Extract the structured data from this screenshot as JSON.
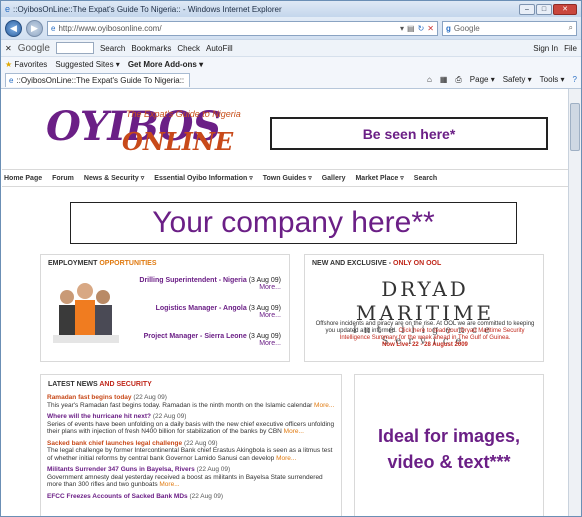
{
  "window": {
    "title": "::OyibosOnLine::The Expat's Guide To Nigeria:: - Windows Internet Explorer",
    "url": "http://www.oyibosonline.com/",
    "search_engine": "Google"
  },
  "google_toolbar": {
    "label": "Google",
    "items": [
      "Search",
      "Bookmarks",
      "Check",
      "AutoFill",
      "Sign In",
      "File"
    ]
  },
  "favorites_bar": {
    "favorites": "Favorites",
    "suggested": "Suggested Sites ▾",
    "addons": "Get More Add-ons ▾"
  },
  "tab": {
    "title": "::OyibosOnLine::The Expat's Guide To Nigeria::"
  },
  "tab_tools": [
    "Page ▾",
    "Safety ▾",
    "Tools ▾"
  ],
  "site": {
    "logo_main": "OYIBOS",
    "logo_sub": "ONLINE",
    "tagline": "The Expat's Guide to Nigeria",
    "banner_top": "Be seen here*",
    "banner_mid": "Your company here**",
    "nav": [
      "Home Page",
      "Forum",
      "News & Security",
      "Essential Oyibo Information",
      "Town Guides",
      "Gallery",
      "Market Place",
      "Search"
    ],
    "employment": {
      "title": "EMPLOYMENT",
      "title_accent": "OPPORTUNITIES",
      "jobs": [
        {
          "title": "Drilling Superintendent - Nigeria",
          "date": "(3 Aug 09)",
          "more": "More..."
        },
        {
          "title": "Logistics Manager - Angola",
          "date": "(3 Aug 09)",
          "more": "More..."
        },
        {
          "title": "Project Manager - Sierra Leone",
          "date": "(3 Aug 09)",
          "more": "More..."
        }
      ]
    },
    "exclusive": {
      "title": "NEW AND EXCLUSIVE -",
      "title_accent": "ONLY ON OOL",
      "brand_line1": "DRYAD MARITIME",
      "brand_line2": "Intelligence Service",
      "text": "Offshore incidents and piracy are on the rise. At OOL we are committed to keeping you updated and informed.",
      "link": "Click here to read your Dryad Maritime Security Intelligence Summary for the week ahead in The Gulf of Guinea.",
      "live": "Now Live: 22 - 28 August 2009"
    },
    "latest_news": {
      "title": "LATEST NEWS",
      "title_accent": "AND SECURITY",
      "items": [
        {
          "headline": "Ramadan fast begins today",
          "date": "(22 Aug 09)",
          "body": "This year's Ramadan fast begins today. Ramadan is the ninth month on the Islamic calendar",
          "more": "More...",
          "color": "orange"
        },
        {
          "headline": "Where will the hurricane hit next?",
          "date": "(22 Aug 09)",
          "body": "Series of events have been unfolding on a daily basis with the new chief executive officers unfolding their plans with injection of fresh N400 billion for stabilization of the banks by CBN",
          "more": "More...",
          "color": "purple"
        },
        {
          "headline": "Sacked bank chief launches legal challenge",
          "date": "(22 Aug 09)",
          "body": "The legal challenge by former Intercontinental Bank chief Erastus Akingbola is seen as a litmus test of whether initial reforms by central bank Governor Lamido Sanusi can develop",
          "more": "More...",
          "color": "orange"
        },
        {
          "headline": "Militants Surrender 347 Guns in Bayelsa, Rivers",
          "date": "(22 Aug 09)",
          "body": "Government amnesty deal yesterday received a boost as militants in Bayelsa State surrendered more than 300 rifles and two gunboats",
          "more": "More...",
          "color": "purple"
        },
        {
          "headline": "EFCC Freezes Accounts of Sacked Bank MDs",
          "date": "(22 Aug 09)",
          "body": "",
          "more": "",
          "color": "purple"
        }
      ]
    },
    "ideal_box": "Ideal for images, video & text***"
  }
}
